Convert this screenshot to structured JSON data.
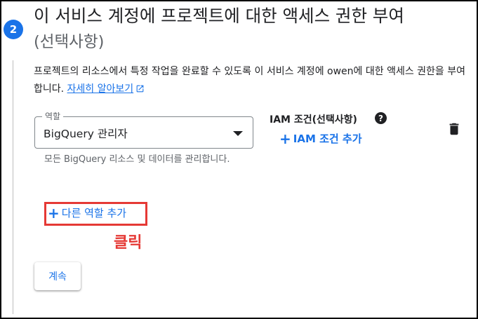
{
  "step": {
    "number": "2",
    "title": "이 서비스 계정에 프로젝트에 대한 액세스 권한 부여",
    "subtitle": "(선택사항)",
    "description": "프로젝트의 리소스에서 특정 작업을 완료할 수 있도록 이 서비스 계정에 owen에 대한 액세스 권한을 부여합니다.",
    "learn_more_link": "자세히 알아보기",
    "icons": {
      "external_link": "open-in-new-icon",
      "badge": "step-number-badge"
    },
    "accent_color": "#1a73e8"
  },
  "role": {
    "label": "역할",
    "value": "BigQuery 관리자",
    "help_text": "모든 BigQuery 리소스 및 데이터를 관리합니다."
  },
  "iam_condition": {
    "label": "IAM 조건(선택사항)",
    "help_icon": "?",
    "add_label": "IAM 조건 추가"
  },
  "actions": {
    "plus_glyph": "+",
    "add_role": "다른 역할 추가",
    "continue": "계속",
    "delete_icon": "trash-icon"
  },
  "annotation": {
    "text": "클릭",
    "color": "#e53935"
  }
}
